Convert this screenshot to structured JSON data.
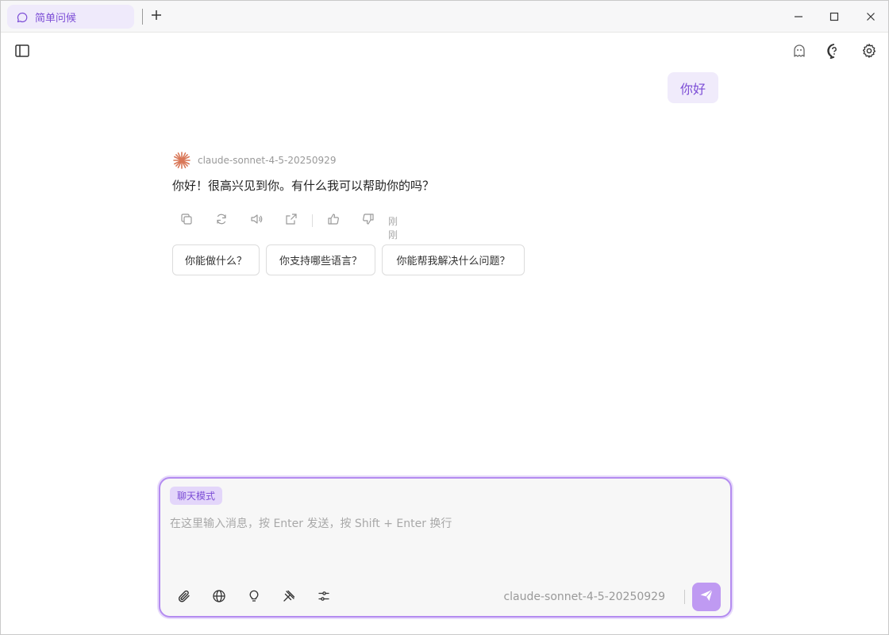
{
  "tab": {
    "title": "简单问候"
  },
  "chat": {
    "user_message": "你好",
    "assistant": {
      "model": "claude-sonnet-4-5-20250929",
      "text": "你好！很高兴见到你。有什么我可以帮助你的吗？",
      "timestamp": "刚刚"
    },
    "suggestions": [
      "你能做什么？",
      "你支持哪些语言？",
      "你能帮我解决什么问题？"
    ]
  },
  "composer": {
    "mode": "聊天模式",
    "placeholder": "在这里输入消息，按 Enter 发送，按 Shift + Enter 换行",
    "value": "",
    "model": "claude-sonnet-4-5-20250929"
  },
  "colors": {
    "accent": "#7c4dd6",
    "accent_light": "#f0ebfb",
    "send": "#bf9af2",
    "logo": "#d97757"
  }
}
